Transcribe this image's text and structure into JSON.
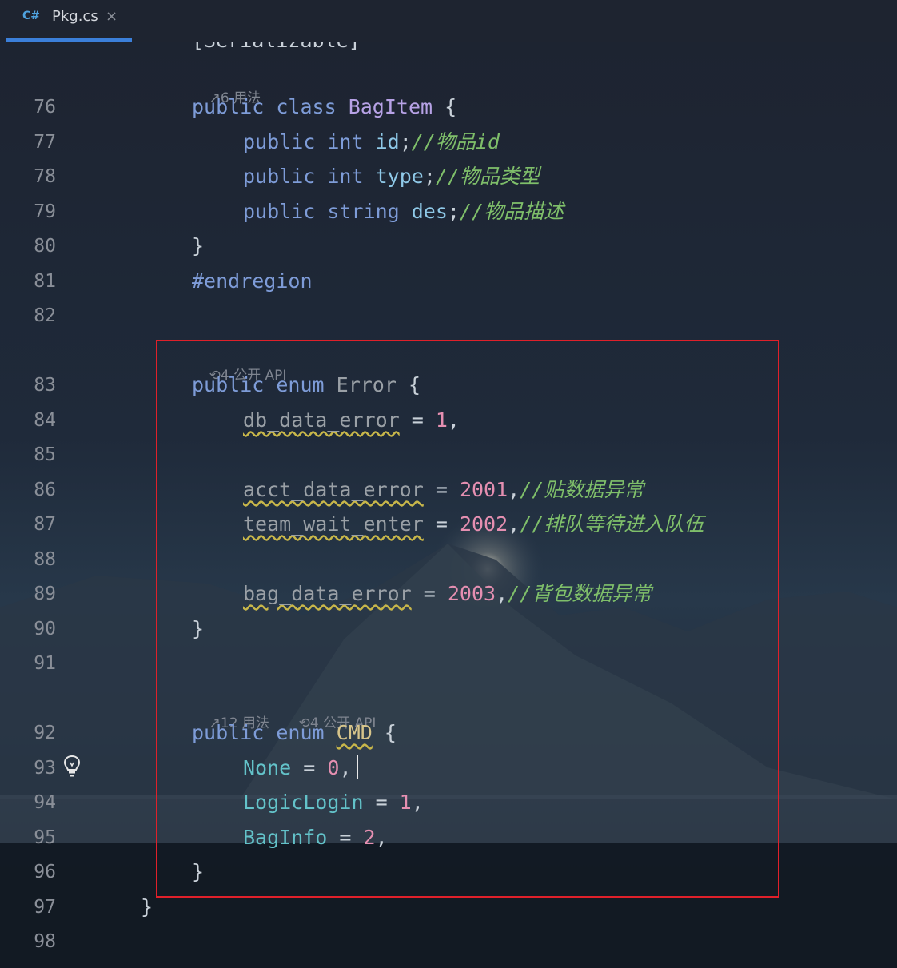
{
  "tab": {
    "lang_badge": "C#",
    "file_name": "Pkg.cs",
    "close_glyph": "×"
  },
  "hints": {
    "bagitem_usages": "6 用法",
    "error_api": "4 公开 API",
    "cmd_usages": "12 用法",
    "cmd_api": "4 公开 API"
  },
  "lines": {
    "l76": {
      "num": "76",
      "kw1": "public",
      "kw2": "class",
      "type": "BagItem",
      "rest": " {"
    },
    "l77": {
      "num": "77",
      "kw1": "public",
      "kw2": "int",
      "field": "id",
      "semi": ";",
      "comment": "//物品id"
    },
    "l78": {
      "num": "78",
      "kw1": "public",
      "kw2": "int",
      "field": "type",
      "semi": ";",
      "comment": "//物品类型"
    },
    "l79": {
      "num": "79",
      "kw1": "public",
      "kw2": "string",
      "field": "des",
      "semi": ";",
      "comment": "//物品描述"
    },
    "l80": {
      "num": "80",
      "text": "}"
    },
    "l81": {
      "num": "81",
      "text": "#endregion"
    },
    "l82": {
      "num": "82"
    },
    "l83": {
      "num": "83",
      "kw1": "public",
      "kw2": "enum",
      "name": "Error",
      "rest": " {"
    },
    "l84": {
      "num": "84",
      "member": "db_data_error",
      "eq": " = ",
      "val": "1",
      "tail": ","
    },
    "l85": {
      "num": "85"
    },
    "l86": {
      "num": "86",
      "member": "acct_data_error",
      "eq": " = ",
      "val": "2001",
      "tail": ",",
      "comment": "//贴数据异常"
    },
    "l87": {
      "num": "87",
      "member": "team_wait_enter",
      "eq": " = ",
      "val": "2002",
      "tail": ",",
      "comment": "//排队等待进入队伍"
    },
    "l88": {
      "num": "88"
    },
    "l89": {
      "num": "89",
      "member": "bag_data_error",
      "eq": " = ",
      "val": "2003",
      "tail": ",",
      "comment": "//背包数据异常"
    },
    "l90": {
      "num": "90",
      "text": "}"
    },
    "l91": {
      "num": "91"
    },
    "l92": {
      "num": "92",
      "kw1": "public",
      "kw2": "enum",
      "name": "CMD",
      "rest": " {"
    },
    "l93": {
      "num": "93",
      "member": "None",
      "eq": " = ",
      "val": "0",
      "tail": ","
    },
    "l94": {
      "num": "94",
      "member": "LogicLogin",
      "eq": " = ",
      "val": "1",
      "tail": ","
    },
    "l95": {
      "num": "95",
      "member": "BagInfo",
      "eq": " = ",
      "val": "2",
      "tail": ","
    },
    "l96": {
      "num": "96",
      "text": "}"
    },
    "l97": {
      "num": "97",
      "text": "}"
    },
    "l98": {
      "num": "98"
    }
  },
  "partial_top": "[Serializable]",
  "colors": {
    "highlight_box": "#e0202a",
    "tab_accent": "#3b7fd9"
  }
}
